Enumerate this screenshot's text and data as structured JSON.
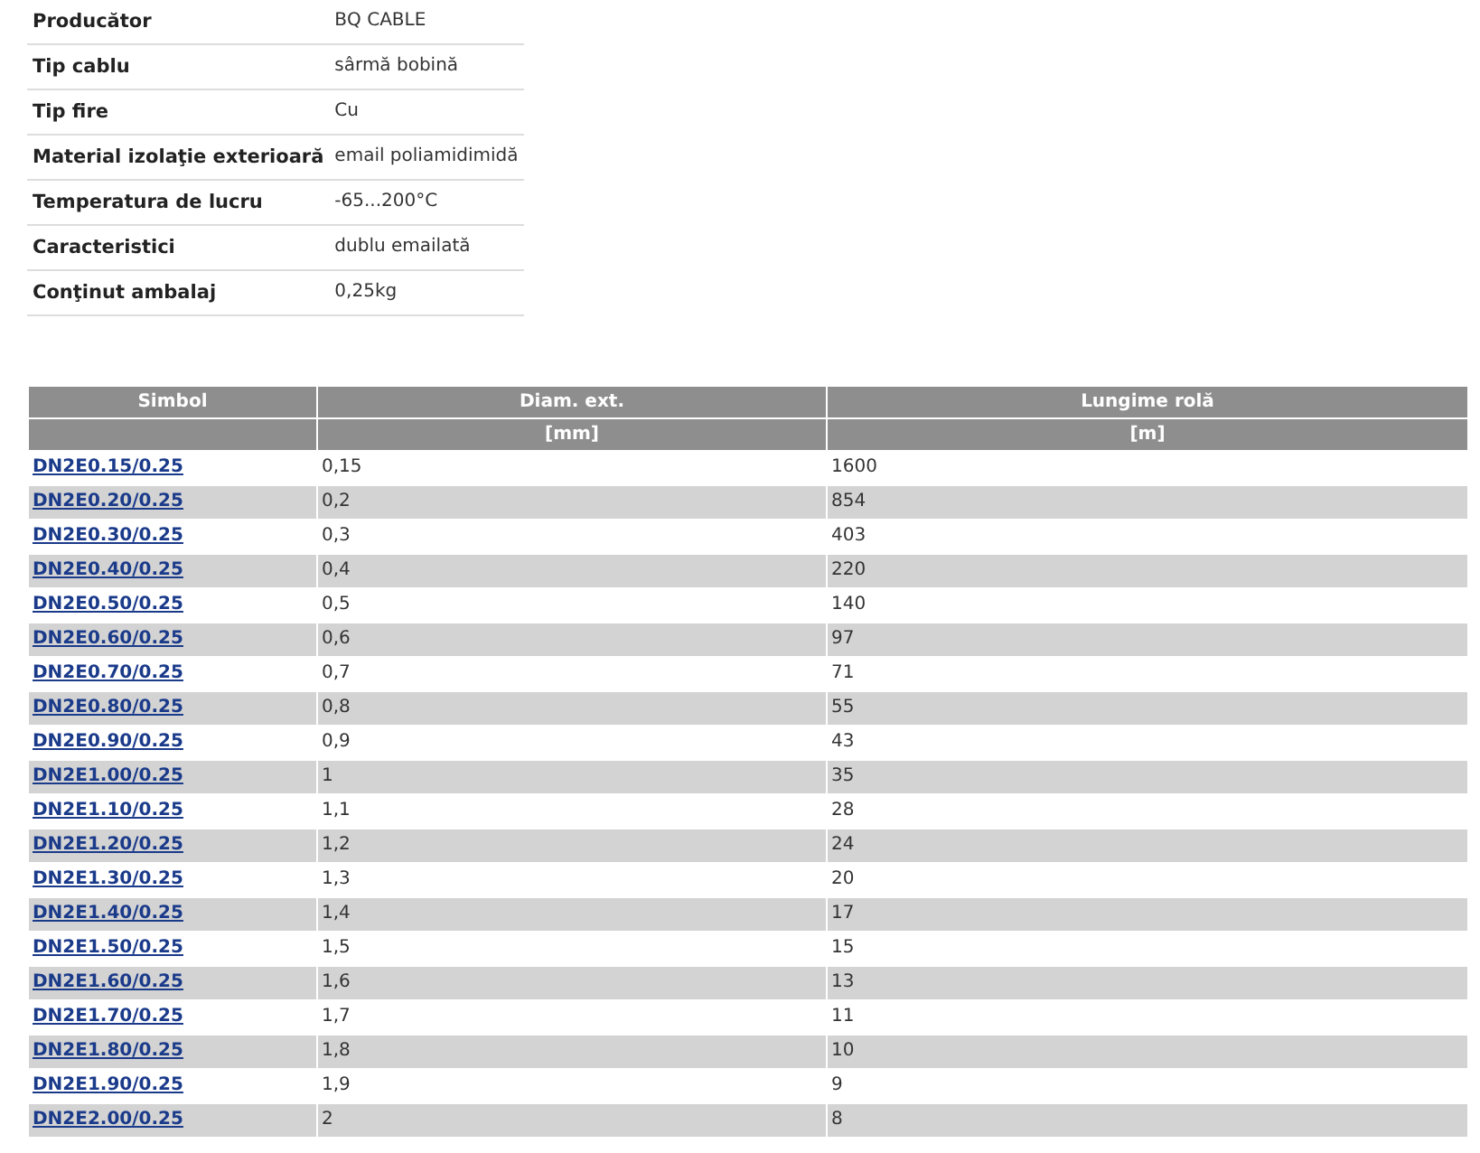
{
  "specs": [
    {
      "label": "Producător",
      "value": "BQ CABLE"
    },
    {
      "label": "Tip cablu",
      "value": "sârmă bobină"
    },
    {
      "label": "Tip fire",
      "value": "Cu"
    },
    {
      "label": "Material izolaţie exterioară",
      "value": "email poliamidimidă"
    },
    {
      "label": "Temperatura de lucru",
      "value": "-65...200°C"
    },
    {
      "label": "Caracteristici",
      "value": "dublu emailată"
    },
    {
      "label": "Conţinut ambalaj",
      "value": "0,25kg"
    }
  ],
  "table": {
    "columns": [
      {
        "title": "Simbol"
      },
      {
        "title": "Diam. ext.",
        "unit": "[mm]"
      },
      {
        "title": "Lungime rolă",
        "unit": "[m]"
      }
    ],
    "rows": [
      [
        "DN2E0.15/0.25",
        "0,15",
        "1600"
      ],
      [
        "DN2E0.20/0.25",
        "0,2",
        "854"
      ],
      [
        "DN2E0.30/0.25",
        "0,3",
        "403"
      ],
      [
        "DN2E0.40/0.25",
        "0,4",
        "220"
      ],
      [
        "DN2E0.50/0.25",
        "0,5",
        "140"
      ],
      [
        "DN2E0.60/0.25",
        "0,6",
        "97"
      ],
      [
        "DN2E0.70/0.25",
        "0,7",
        "71"
      ],
      [
        "DN2E0.80/0.25",
        "0,8",
        "55"
      ],
      [
        "DN2E0.90/0.25",
        "0,9",
        "43"
      ],
      [
        "DN2E1.00/0.25",
        "1",
        "35"
      ],
      [
        "DN2E1.10/0.25",
        "1,1",
        "28"
      ],
      [
        "DN2E1.20/0.25",
        "1,2",
        "24"
      ],
      [
        "DN2E1.30/0.25",
        "1,3",
        "20"
      ],
      [
        "DN2E1.40/0.25",
        "1,4",
        "17"
      ],
      [
        "DN2E1.50/0.25",
        "1,5",
        "15"
      ],
      [
        "DN2E1.60/0.25",
        "1,6",
        "13"
      ],
      [
        "DN2E1.70/0.25",
        "1,7",
        "11"
      ],
      [
        "DN2E1.80/0.25",
        "1,8",
        "10"
      ],
      [
        "DN2E1.90/0.25",
        "1,9",
        "9"
      ],
      [
        "DN2E2.00/0.25",
        "2",
        "8"
      ]
    ]
  }
}
